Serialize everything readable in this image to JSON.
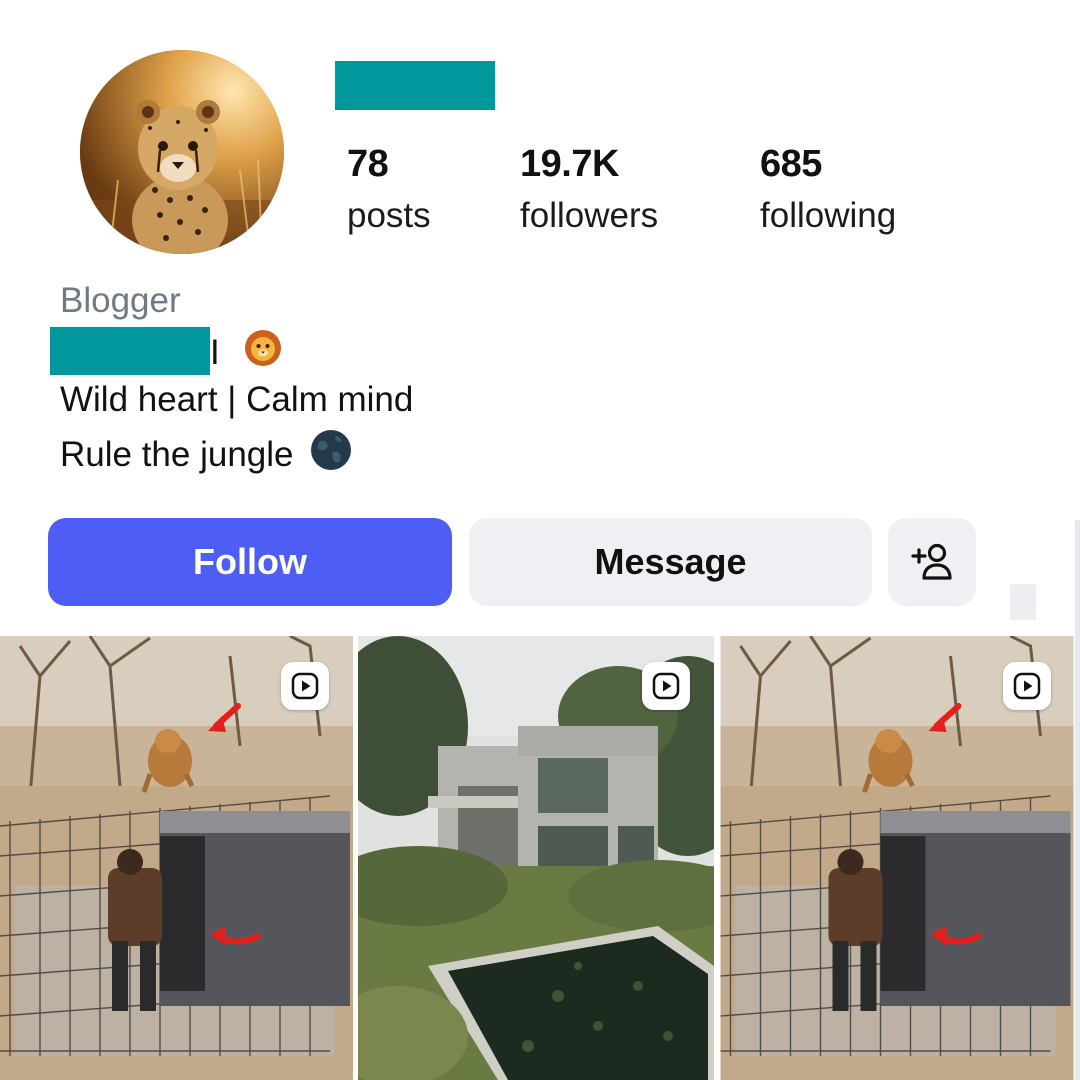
{
  "profile": {
    "avatar_icon": "cheetah-cub-photo",
    "username_redacted": true,
    "stats": [
      {
        "value": "78",
        "label": "posts"
      },
      {
        "value": "19.7K",
        "label": "followers"
      },
      {
        "value": "685",
        "label": "following"
      }
    ],
    "category": "Blogger",
    "bio": {
      "line1_suffix": "I",
      "line1_emoji": "lion-face-icon",
      "line2": "Wild heart | Calm mind",
      "line3": "Rule the jungle",
      "line3_emoji": "globe-icon"
    }
  },
  "actions": {
    "follow_label": "Follow",
    "message_label": "Message",
    "add_user_icon": "add-user-icon"
  },
  "colors": {
    "redaction": "#00989c",
    "follow_button": "#4e5df3",
    "secondary_button": "#eef0f4",
    "category_text": "#6f7a85"
  },
  "posts": [
    {
      "type": "reel",
      "icon": "reel-play-icon"
    },
    {
      "type": "reel",
      "icon": "reel-play-icon"
    },
    {
      "type": "reel",
      "icon": "reel-play-icon"
    }
  ]
}
